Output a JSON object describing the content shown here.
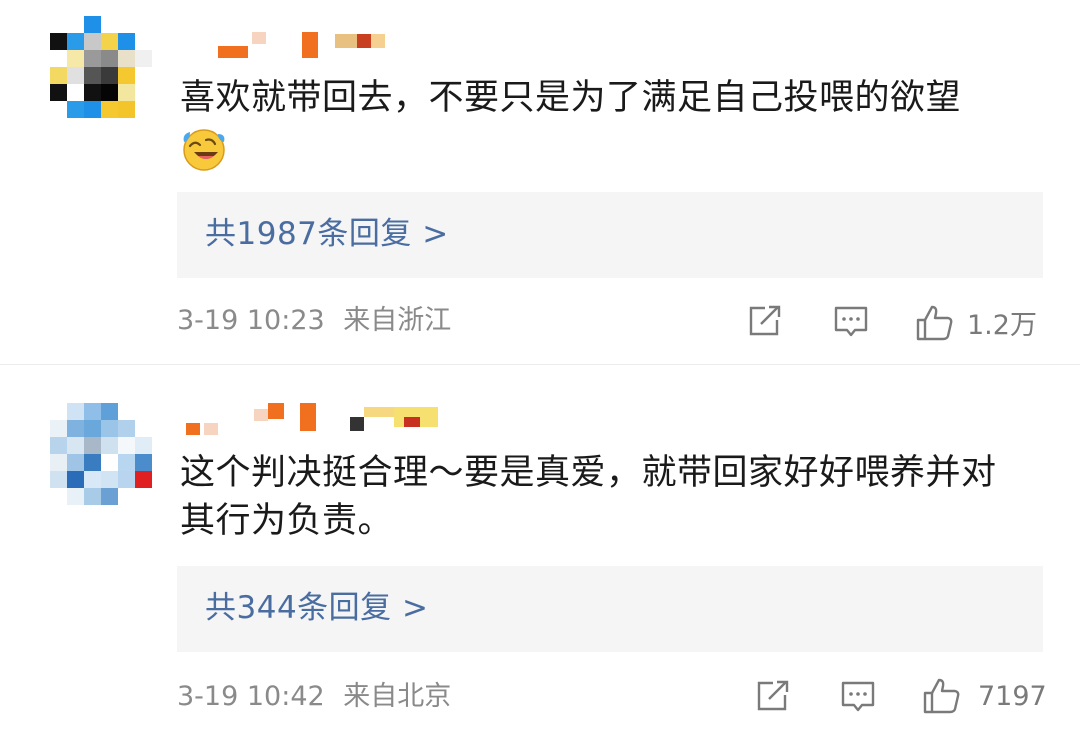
{
  "comments": [
    {
      "text": "喜欢就带回去，不要只是为了满足自己投喂的欲望",
      "emoji": "laughing-crying-emoji",
      "reply_label": "共1987条回复 >",
      "time": "3-19 10:23",
      "location": "来自浙江",
      "likes": "1.2万"
    },
    {
      "text": "这个判决挺合理～要是真爱，就带回家好好喂养并对其行为负责。",
      "reply_label": "共344条回复 >",
      "time": "3-19 10:42",
      "location": "来自北京",
      "likes": "7197"
    }
  ],
  "icons": {
    "share": "share-icon",
    "comment": "comment-icon",
    "like": "thumbs-up-icon"
  },
  "colors": {
    "link": "#4a6da1",
    "meta": "#8a8a8a",
    "reply_bg": "#f5f5f5",
    "text": "#1a1a1a"
  }
}
